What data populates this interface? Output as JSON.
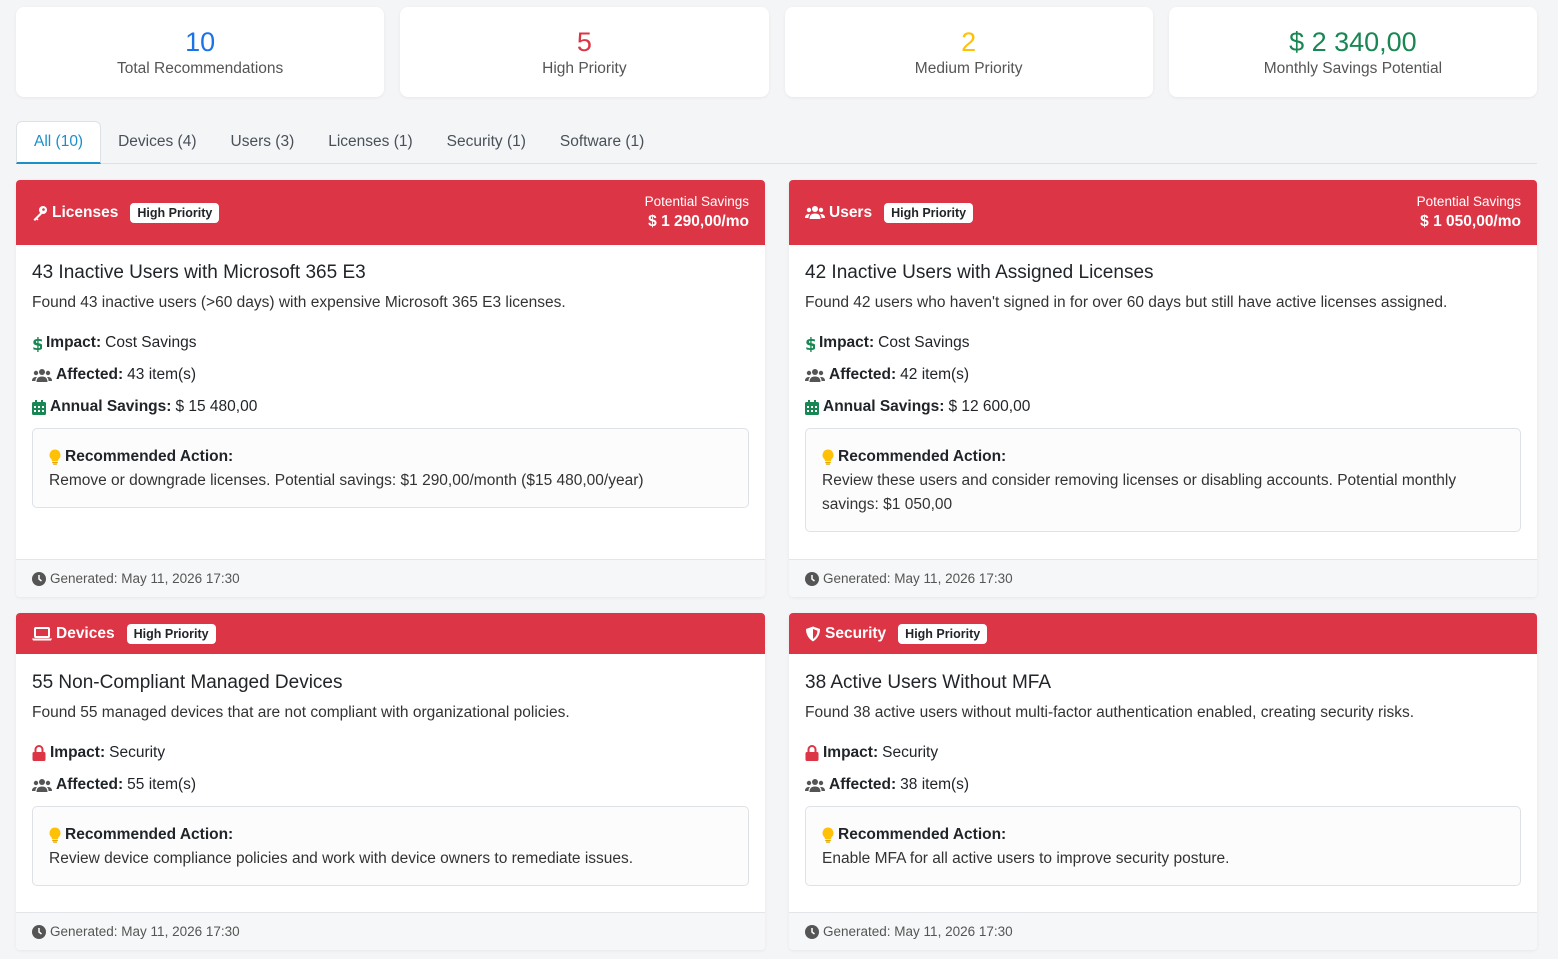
{
  "stats": [
    {
      "value": "10",
      "label": "Total Recommendations",
      "color": "#1a73e8"
    },
    {
      "value": "5",
      "label": "High Priority",
      "color": "#dc3545"
    },
    {
      "value": "2",
      "label": "Medium Priority",
      "color": "#ffc107"
    },
    {
      "value": "$ 2 340,00",
      "label": "Monthly Savings Potential",
      "color": "#198754"
    }
  ],
  "tabs": [
    "All (10)",
    "Devices (4)",
    "Users (3)",
    "Licenses (1)",
    "Security (1)",
    "Software (1)"
  ],
  "cards": [
    {
      "category": "Licenses",
      "priority": "High Priority",
      "savings_label": "Potential Savings",
      "savings_value": "$ 1 290,00/mo",
      "title": "43 Inactive Users with Microsoft 365 E3",
      "description": "Found 43 inactive users (>60 days) with expensive Microsoft 365 E3 licenses.",
      "impact_label": "Impact:",
      "impact": "Cost Savings",
      "affected_label": "Affected:",
      "affected": "43 item(s)",
      "annual_label": "Annual Savings:",
      "annual": "$ 15 480,00",
      "action_label": "Recommended Action:",
      "action": "Remove or downgrade licenses. Potential savings: $1 290,00/month ($15 480,00/year)",
      "generated": "Generated: May 11, 2026 17:30"
    },
    {
      "category": "Users",
      "priority": "High Priority",
      "savings_label": "Potential Savings",
      "savings_value": "$ 1 050,00/mo",
      "title": "42 Inactive Users with Assigned Licenses",
      "description": "Found 42 users who haven't signed in for over 60 days but still have active licenses assigned.",
      "impact_label": "Impact:",
      "impact": "Cost Savings",
      "affected_label": "Affected:",
      "affected": "42 item(s)",
      "annual_label": "Annual Savings:",
      "annual": "$ 12 600,00",
      "action_label": "Recommended Action:",
      "action": "Review these users and consider removing licenses or disabling accounts. Potential monthly savings: $1 050,00",
      "generated": "Generated: May 11, 2026 17:30"
    },
    {
      "category": "Devices",
      "priority": "High Priority",
      "title": "55 Non-Compliant Managed Devices",
      "description": "Found 55 managed devices that are not compliant with organizational policies.",
      "impact_label": "Impact:",
      "impact": "Security",
      "affected_label": "Affected:",
      "affected": "55 item(s)",
      "action_label": "Recommended Action:",
      "action": "Review device compliance policies and work with device owners to remediate issues.",
      "generated": "Generated: May 11, 2026 17:30"
    },
    {
      "category": "Security",
      "priority": "High Priority",
      "title": "38 Active Users Without MFA",
      "description": "Found 38 active users without multi-factor authentication enabled, creating security risks.",
      "impact_label": "Impact:",
      "impact": "Security",
      "affected_label": "Affected:",
      "affected": "38 item(s)",
      "action_label": "Recommended Action:",
      "action": "Enable MFA for all active users to improve security posture.",
      "generated": "Generated: May 11, 2026 17:30"
    }
  ],
  "icons": {
    "dollar": "dollar-icon",
    "users": "users-icon",
    "calendar": "calendar-icon",
    "lock": "lock-icon",
    "bulb": "lightbulb-icon",
    "clock": "clock-icon",
    "key": "key-icon",
    "laptop": "laptop-icon",
    "shield": "shield-icon"
  },
  "colors": {
    "header_red": "#dc3545",
    "savings_green": "#198754",
    "accent_blue": "#1a8fc9",
    "bulb_yellow": "#ffc107"
  }
}
